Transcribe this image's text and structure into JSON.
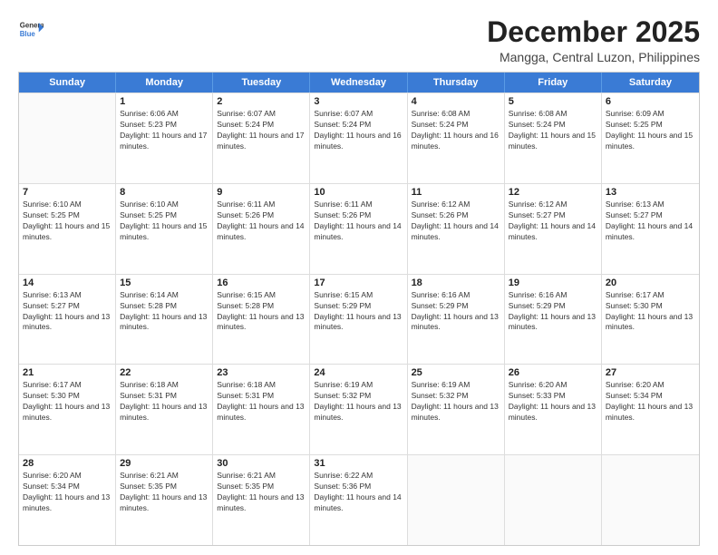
{
  "header": {
    "logo_line1": "General",
    "logo_line2": "Blue",
    "month_title": "December 2025",
    "location": "Mangga, Central Luzon, Philippines"
  },
  "weekdays": [
    "Sunday",
    "Monday",
    "Tuesday",
    "Wednesday",
    "Thursday",
    "Friday",
    "Saturday"
  ],
  "rows": [
    [
      {
        "day": "",
        "empty": true
      },
      {
        "day": "1",
        "sunrise": "6:06 AM",
        "sunset": "5:23 PM",
        "daylight": "11 hours and 17 minutes."
      },
      {
        "day": "2",
        "sunrise": "6:07 AM",
        "sunset": "5:24 PM",
        "daylight": "11 hours and 17 minutes."
      },
      {
        "day": "3",
        "sunrise": "6:07 AM",
        "sunset": "5:24 PM",
        "daylight": "11 hours and 16 minutes."
      },
      {
        "day": "4",
        "sunrise": "6:08 AM",
        "sunset": "5:24 PM",
        "daylight": "11 hours and 16 minutes."
      },
      {
        "day": "5",
        "sunrise": "6:08 AM",
        "sunset": "5:24 PM",
        "daylight": "11 hours and 15 minutes."
      },
      {
        "day": "6",
        "sunrise": "6:09 AM",
        "sunset": "5:25 PM",
        "daylight": "11 hours and 15 minutes."
      }
    ],
    [
      {
        "day": "7",
        "sunrise": "6:10 AM",
        "sunset": "5:25 PM",
        "daylight": "11 hours and 15 minutes."
      },
      {
        "day": "8",
        "sunrise": "6:10 AM",
        "sunset": "5:25 PM",
        "daylight": "11 hours and 15 minutes."
      },
      {
        "day": "9",
        "sunrise": "6:11 AM",
        "sunset": "5:26 PM",
        "daylight": "11 hours and 14 minutes."
      },
      {
        "day": "10",
        "sunrise": "6:11 AM",
        "sunset": "5:26 PM",
        "daylight": "11 hours and 14 minutes."
      },
      {
        "day": "11",
        "sunrise": "6:12 AM",
        "sunset": "5:26 PM",
        "daylight": "11 hours and 14 minutes."
      },
      {
        "day": "12",
        "sunrise": "6:12 AM",
        "sunset": "5:27 PM",
        "daylight": "11 hours and 14 minutes."
      },
      {
        "day": "13",
        "sunrise": "6:13 AM",
        "sunset": "5:27 PM",
        "daylight": "11 hours and 14 minutes."
      }
    ],
    [
      {
        "day": "14",
        "sunrise": "6:13 AM",
        "sunset": "5:27 PM",
        "daylight": "11 hours and 13 minutes."
      },
      {
        "day": "15",
        "sunrise": "6:14 AM",
        "sunset": "5:28 PM",
        "daylight": "11 hours and 13 minutes."
      },
      {
        "day": "16",
        "sunrise": "6:15 AM",
        "sunset": "5:28 PM",
        "daylight": "11 hours and 13 minutes."
      },
      {
        "day": "17",
        "sunrise": "6:15 AM",
        "sunset": "5:29 PM",
        "daylight": "11 hours and 13 minutes."
      },
      {
        "day": "18",
        "sunrise": "6:16 AM",
        "sunset": "5:29 PM",
        "daylight": "11 hours and 13 minutes."
      },
      {
        "day": "19",
        "sunrise": "6:16 AM",
        "sunset": "5:29 PM",
        "daylight": "11 hours and 13 minutes."
      },
      {
        "day": "20",
        "sunrise": "6:17 AM",
        "sunset": "5:30 PM",
        "daylight": "11 hours and 13 minutes."
      }
    ],
    [
      {
        "day": "21",
        "sunrise": "6:17 AM",
        "sunset": "5:30 PM",
        "daylight": "11 hours and 13 minutes."
      },
      {
        "day": "22",
        "sunrise": "6:18 AM",
        "sunset": "5:31 PM",
        "daylight": "11 hours and 13 minutes."
      },
      {
        "day": "23",
        "sunrise": "6:18 AM",
        "sunset": "5:31 PM",
        "daylight": "11 hours and 13 minutes."
      },
      {
        "day": "24",
        "sunrise": "6:19 AM",
        "sunset": "5:32 PM",
        "daylight": "11 hours and 13 minutes."
      },
      {
        "day": "25",
        "sunrise": "6:19 AM",
        "sunset": "5:32 PM",
        "daylight": "11 hours and 13 minutes."
      },
      {
        "day": "26",
        "sunrise": "6:20 AM",
        "sunset": "5:33 PM",
        "daylight": "11 hours and 13 minutes."
      },
      {
        "day": "27",
        "sunrise": "6:20 AM",
        "sunset": "5:34 PM",
        "daylight": "11 hours and 13 minutes."
      }
    ],
    [
      {
        "day": "28",
        "sunrise": "6:20 AM",
        "sunset": "5:34 PM",
        "daylight": "11 hours and 13 minutes."
      },
      {
        "day": "29",
        "sunrise": "6:21 AM",
        "sunset": "5:35 PM",
        "daylight": "11 hours and 13 minutes."
      },
      {
        "day": "30",
        "sunrise": "6:21 AM",
        "sunset": "5:35 PM",
        "daylight": "11 hours and 13 minutes."
      },
      {
        "day": "31",
        "sunrise": "6:22 AM",
        "sunset": "5:36 PM",
        "daylight": "11 hours and 14 minutes."
      },
      {
        "day": "",
        "empty": true
      },
      {
        "day": "",
        "empty": true
      },
      {
        "day": "",
        "empty": true
      }
    ]
  ],
  "labels": {
    "sunrise": "Sunrise: ",
    "sunset": "Sunset: ",
    "daylight": "Daylight: "
  }
}
